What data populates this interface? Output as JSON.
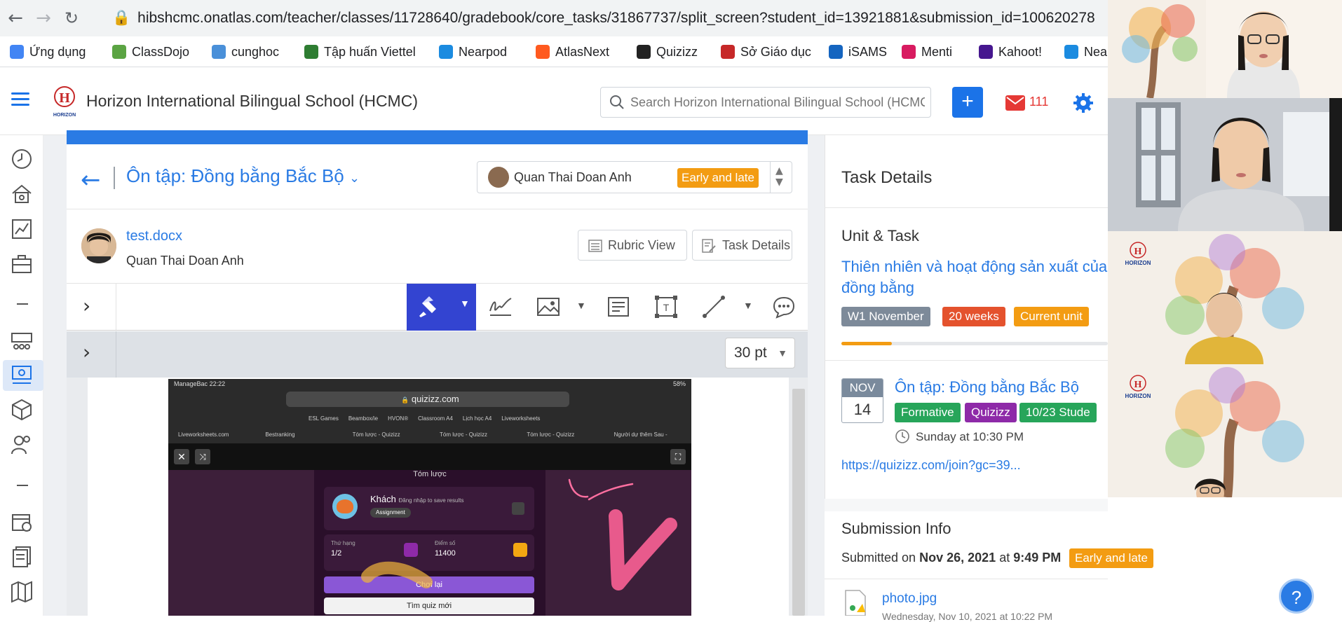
{
  "browser": {
    "url": "hibshcmc.onatlas.com/teacher/classes/11728640/gradebook/core_tasks/31867737/split_screen?student_id=13921881&submission_id=100620278",
    "bookmarks": [
      {
        "label": "Ứng dụng",
        "color": "#4285f4"
      },
      {
        "label": "ClassDojo",
        "color": "#5ba443"
      },
      {
        "label": "cunghoc",
        "color": "#4a90d9"
      },
      {
        "label": "Tập huấn Viettel",
        "color": "#2e7d32"
      },
      {
        "label": "Nearpod",
        "color": "#1b8be0"
      },
      {
        "label": "AtlasNext",
        "color": "#ff5a1f"
      },
      {
        "label": "Quizizz",
        "color": "#222222"
      },
      {
        "label": "Sở Giáo dục",
        "color": "#c62828"
      },
      {
        "label": "iSAMS",
        "color": "#1565c0"
      },
      {
        "label": "Menti",
        "color": "#d81b60"
      },
      {
        "label": "Kahoot!",
        "color": "#46178f"
      },
      {
        "label": "Nea",
        "color": "#1b8be0"
      }
    ]
  },
  "header": {
    "school_name": "Horizon International Bilingual School (HCMC)",
    "logo_text": "HORIZON",
    "search_placeholder": "Search Horizon International Bilingual School (HCMC)",
    "add_label": "+",
    "mail_count": "111"
  },
  "task": {
    "title": "Ôn tập: Đồng bằng Bắc Bộ",
    "student_select_name": "Quan Thai Doan Anh",
    "status": "Early and late",
    "file_name": "test.docx",
    "student_name": "Quan Thai Doan Anh",
    "rubric_view_label": "Rubric View",
    "task_details_label": "Task Details",
    "pen_size": "30 pt"
  },
  "screenshot_content": {
    "ipad_url": "quizizz.com",
    "ipad_time": "22:22",
    "ipad_carrier": "ManageBac",
    "ipad_battery": "58%",
    "ipad_bookmarks": [
      "ESL Games",
      "Beambox/ie",
      "HVON®",
      "Classroom A4",
      "Lịch học A4",
      "Liveworksheets"
    ],
    "ipad_tabs": [
      "Liveworksheets.com",
      "Bestranking",
      "Tóm lược - Quizizz",
      "Tóm lược - Quizizz",
      "Tóm lược - Quizizz",
      "Người dự thêm Sau -"
    ],
    "summary_label": "Tóm lược",
    "player_name": "Khách",
    "player_hint": "Đăng nhập to save results",
    "assignment_label": "Assignment",
    "rank_label": "Thứ hạng",
    "rank_value": "1/2",
    "score_label": "Điểm số",
    "score_value": "11400",
    "play_again": "Chơi lại",
    "new_quiz": "Tìm quiz mới"
  },
  "details": {
    "heading": "Task Details",
    "unit_heading": "Unit & Task",
    "unit_title": "Thiên nhiên và hoạt động sản xuất của đồng bằng",
    "badges": [
      {
        "label": "W1 November",
        "color": "#7d8a99"
      },
      {
        "label": "20 weeks",
        "color": "#e4522d"
      },
      {
        "label": "Current unit",
        "color": "#f39c12"
      }
    ],
    "unit_progress": 0.19,
    "date_month": "NOV",
    "date_day": "14",
    "task_link": "Ôn tập: Đồng bằng Bắc Bộ",
    "task_badges": [
      {
        "label": "Formative",
        "color": "#27a55a"
      },
      {
        "label": "Quizizz",
        "color": "#8e2aa8"
      },
      {
        "label": "10/23 Stude",
        "color": "#27a55a"
      }
    ],
    "due": "Sunday at 10:30 PM",
    "quiz_url": "https://quizizz.com/join?gc=39..."
  },
  "submission": {
    "heading": "Submission Info",
    "submitted_prefix": "Submitted on",
    "submitted_date": "Nov 26, 2021",
    "at_word": "at",
    "submitted_time": "9:49 PM",
    "status": "Early and late",
    "attachment_name": "photo.jpg",
    "attachment_date": "Wednesday, Nov 10, 2021 at 10:22 PM"
  },
  "help_label": "?",
  "video_tiles": [
    {
      "logo": "HORIZON"
    },
    {
      "logo": ""
    },
    {
      "logo": "HORIZON"
    },
    {
      "logo": "HORIZON"
    }
  ]
}
